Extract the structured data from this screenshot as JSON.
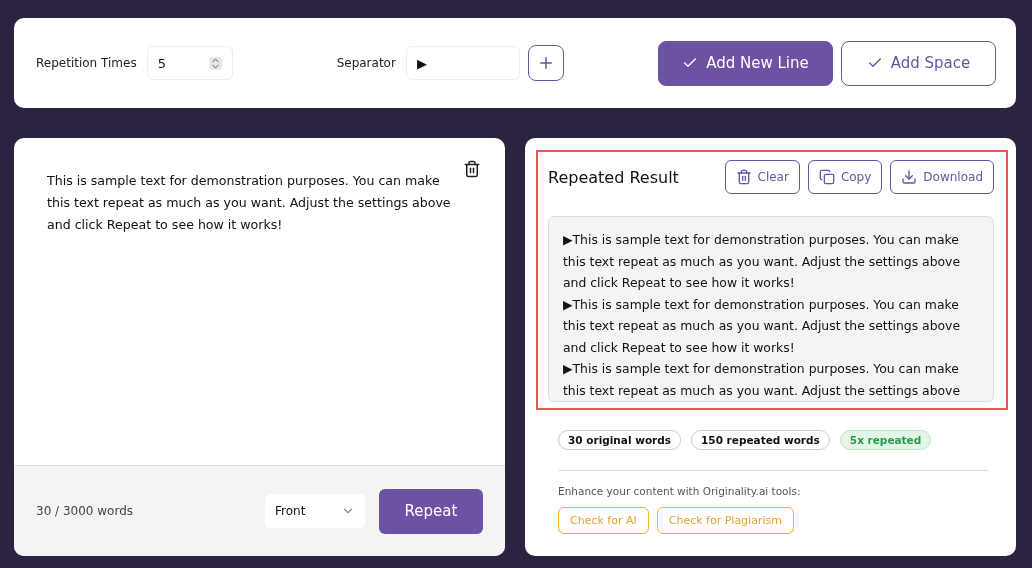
{
  "settings": {
    "repetition_label": "Repetition Times",
    "repetition_value": "5",
    "separator_label": "Separator",
    "separator_value": "▶",
    "buttons": [
      {
        "label": "Add New Line",
        "selected": true
      },
      {
        "label": "Add Space",
        "selected": false
      }
    ]
  },
  "input": {
    "text": "This is sample text for demonstration purposes. You can make this text repeat as much as you want. Adjust the settings above and click Repeat to see how it works!",
    "word_count": "30 / 3000 words",
    "position": "Front",
    "action": "Repeat"
  },
  "result": {
    "title": "Repeated Result",
    "highlighted": true,
    "actions": [
      {
        "kind": "clear",
        "label": "Clear"
      },
      {
        "kind": "copy",
        "label": "Copy"
      },
      {
        "kind": "download",
        "label": "Download"
      }
    ],
    "lines": [
      "▶This is sample text for demonstration purposes. You can make this text repeat as much as you want. Adjust the settings above and click Repeat to see how it works!",
      "▶This is sample text for demonstration purposes. You can make this text repeat as much as you want. Adjust the settings above and click Repeat to see how it works!",
      "▶This is sample text for demonstration purposes. You can make this text repeat as much as you want. Adjust the settings above"
    ],
    "stats": [
      {
        "label": "30 original words",
        "kind": "plain"
      },
      {
        "label": "150 repeated words",
        "kind": "plain"
      },
      {
        "label": "5x repeated",
        "kind": "success"
      }
    ],
    "promo": "Enhance your content with Originality.ai tools:",
    "tools": [
      "Check for AI",
      "Check for Plagiarism"
    ]
  }
}
